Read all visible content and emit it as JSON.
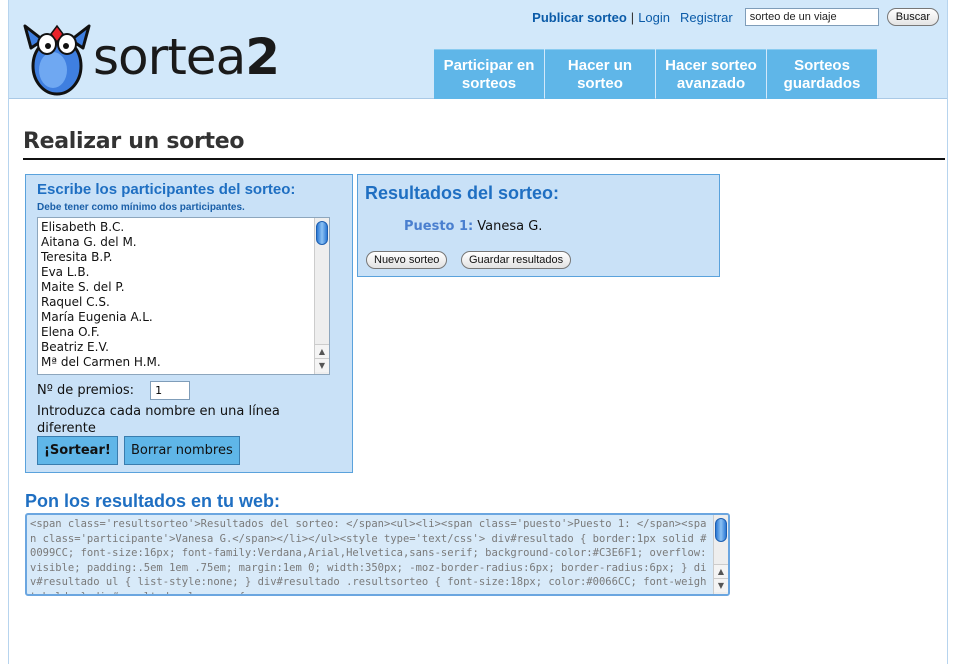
{
  "header": {
    "logo_text": "sortea",
    "logo_suffix": "2",
    "publish_link": "Publicar sorteo",
    "separator": "|",
    "login_link": "Login",
    "register_link": "Registrar",
    "search_value": "sorteo de un viaje",
    "search_button": "Buscar",
    "nav": [
      {
        "label": "Participar en\nsorteos"
      },
      {
        "label": "Hacer un\nsorteo"
      },
      {
        "label": "Hacer sorteo\navanzado"
      },
      {
        "label": "Sorteos\nguardados"
      }
    ]
  },
  "main": {
    "title": "Realizar un sorteo",
    "participants": {
      "heading": "Escribe los participantes del sorteo:",
      "note": "Debe tener como mínimo dos participantes.",
      "names": [
        "Elisabeth B.C.",
        "Aitana G. del M.",
        "Teresita B.P.",
        "Eva L.B.",
        "Maite S. del P.",
        "Raquel C.S.",
        "María Eugenia A.L.",
        "Elena O.F.",
        "Beatriz E.V.",
        "Mª del Carmen H.M."
      ],
      "prizes_label": "Nº de premios:",
      "prizes_value": "1",
      "hint": "Introduzca cada nombre en una línea diferente",
      "draw_button": "¡Sortear!",
      "clear_button": "Borrar nombres"
    },
    "results": {
      "heading": "Resultados del sorteo:",
      "position_label": "Puesto 1:",
      "winner": "Vanesa G.",
      "new_button": "Nuevo sorteo",
      "save_button": "Guardar resultados"
    },
    "embed": {
      "heading": "Pon los resultados en tu web:",
      "code": "<span class='resultsorteo'>Resultados del sorteo: </span><ul><li><span class='puesto'>Puesto 1: </span><span class='participante'>Vanesa G.</span></li></ul><style type='text/css'> div#resultado { border:1px solid #0099CC; font-size:16px; font-family:Verdana,Arial,Helvetica,sans-serif; background-color:#C3E6F1; overflow:visible; padding:.5em 1em .75em; margin:1em 0; width:350px; -moz-border-radius:6px; border-radius:6px; } div#resultado ul { list-style:none; } div#resultado .resultsorteo { font-size:18px; color:#0066CC; font-weight:bold; } div#resultado ul.grupo {"
    }
  },
  "colors": {
    "header_bg": "#d2e8fa",
    "nav_tab": "#5fb6e8",
    "panel_bg": "#c9e1f7",
    "heading_blue": "#1f6fc2"
  }
}
